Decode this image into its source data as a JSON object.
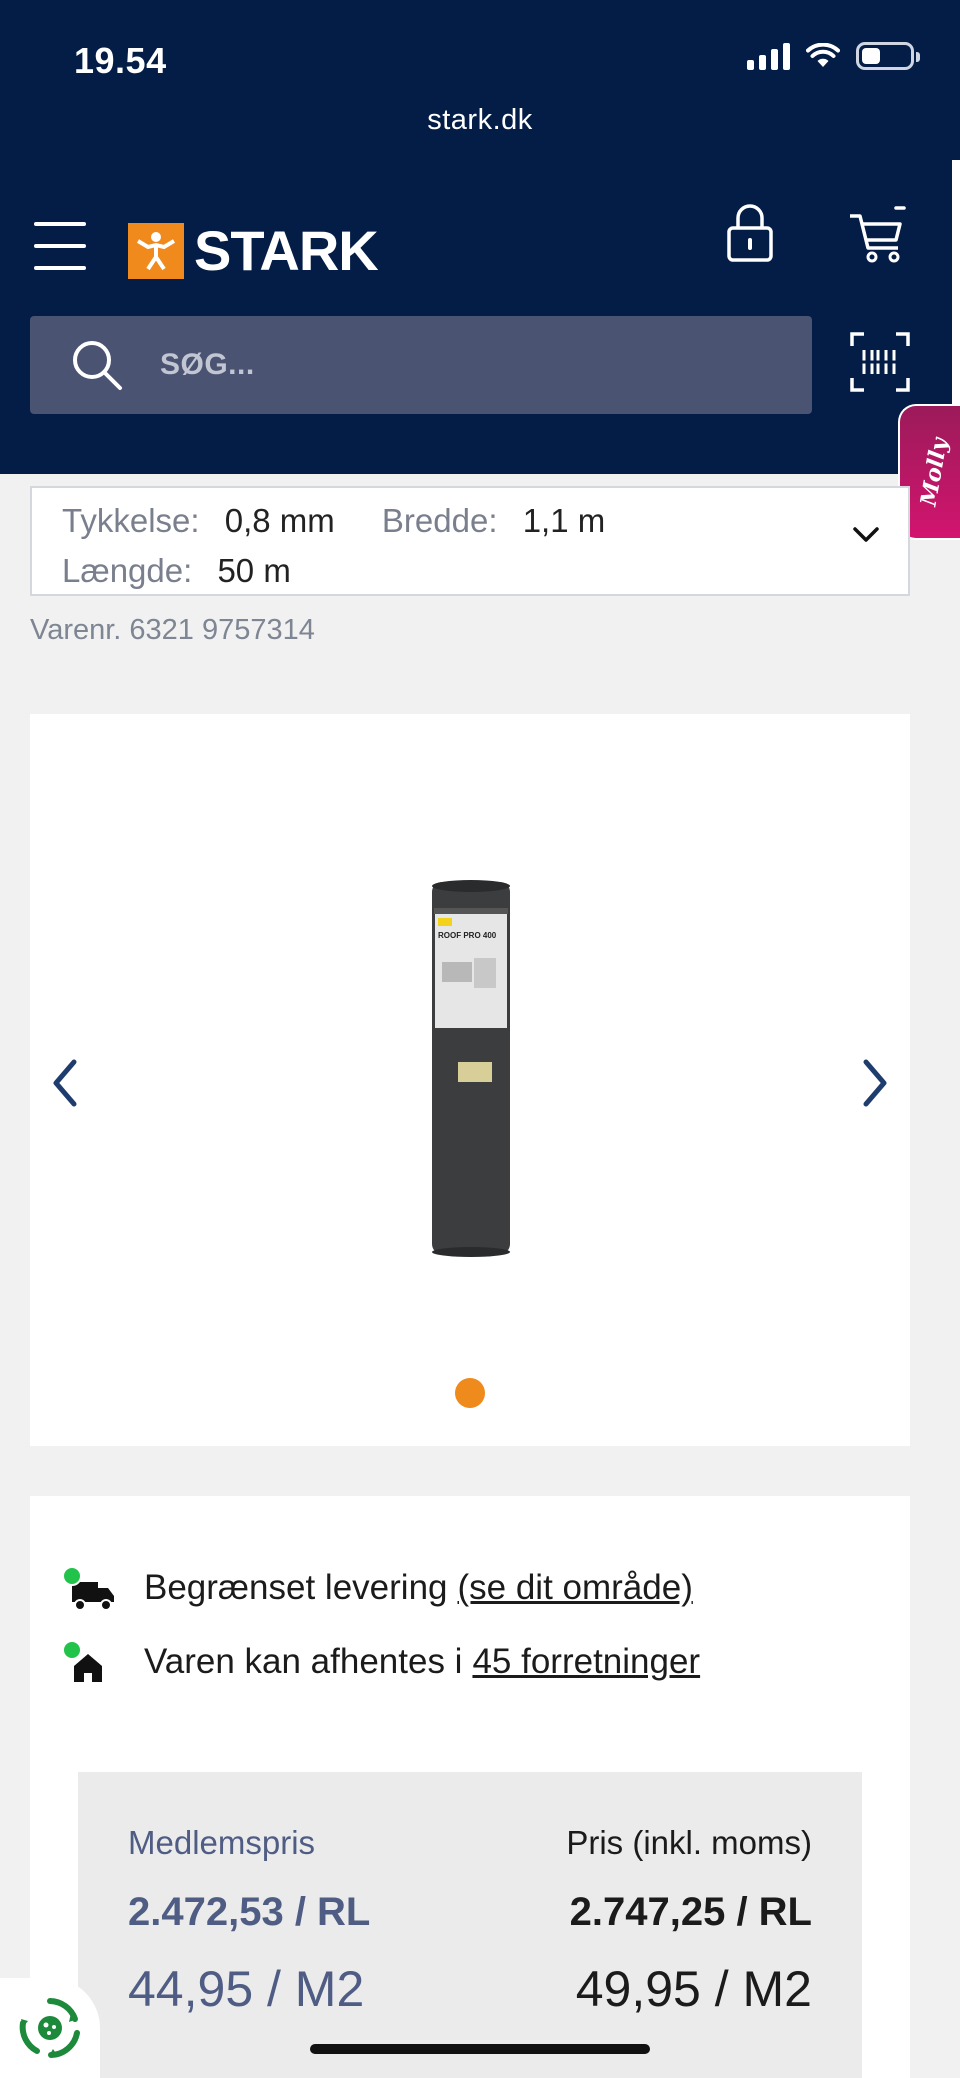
{
  "status_bar": {
    "time": "19.54"
  },
  "browser": {
    "url": "stark.dk"
  },
  "header": {
    "logo_text": "STARK"
  },
  "search": {
    "placeholder": "SØG..."
  },
  "side_tab": {
    "label": "Molly"
  },
  "variant": {
    "thickness_label": "Tykkelse:",
    "thickness_value": "0,8 mm",
    "width_label": "Bredde:",
    "width_value": "1,1 m",
    "length_label": "Længde:",
    "length_value": "50 m"
  },
  "sku": "Varenr. 6321 9757314",
  "gallery": {
    "image_label": "ROOF PRO 400"
  },
  "availability": {
    "delivery_text": "Begrænset levering",
    "delivery_link": "(se dit område)",
    "pickup_text": "Varen kan afhentes i",
    "pickup_link": "45 forretninger"
  },
  "pricing": {
    "member_label": "Medlemspris",
    "member_price": "2.472,53 / RL",
    "member_unit_price": "44,95 / M2",
    "price_label": "Pris (inkl. moms)",
    "price": "2.747,25 / RL",
    "unit_price": "49,95 / M2"
  },
  "colors": {
    "header_bg": "#041d46",
    "brand_orange": "#f08a1c",
    "member_blue": "#4f5c84",
    "available_green": "#22c34a",
    "molly_pink": "#d3146f"
  }
}
